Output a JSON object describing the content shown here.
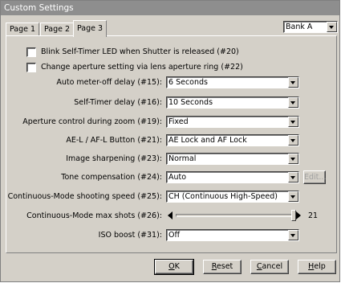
{
  "window": {
    "title": "Custom Settings"
  },
  "tabs": [
    {
      "label": "Page 1"
    },
    {
      "label": "Page 2"
    },
    {
      "label": "Page 3"
    }
  ],
  "bank": {
    "value": "Bank A"
  },
  "checkboxes": [
    {
      "label": "Blink Self-Timer LED when Shutter is released (#20)",
      "checked": false
    },
    {
      "label": "Change aperture setting via lens aperture ring (#22)",
      "checked": false
    }
  ],
  "settings": [
    {
      "label": "Auto meter-off delay (#15):",
      "value": "6 Seconds"
    },
    {
      "label": "Self-Timer delay (#16):",
      "value": "10 Seconds"
    },
    {
      "label": "Aperture control during zoom (#19):",
      "value": "Fixed"
    },
    {
      "label": "AE-L / AF-L Button (#21):",
      "value": "AE Lock and AF Lock"
    },
    {
      "label": "Image sharpening (#23):",
      "value": "Normal"
    },
    {
      "label": "Tone compensation (#24):",
      "value": "Auto"
    },
    {
      "label": "Continuous-Mode shooting speed (#25):",
      "value": "CH (Continuous High-Speed)"
    },
    {
      "label": "Continuous-Mode max shots (#26):",
      "value": "21",
      "fraction": 1.0
    },
    {
      "label": "ISO boost (#31):",
      "value": "Off"
    }
  ],
  "edit_button": {
    "label": "Edit..."
  },
  "buttons": {
    "ok": {
      "label": "OK",
      "underline": "O",
      "rest": "K"
    },
    "reset": {
      "label": "Reset",
      "underline": "R",
      "rest": "eset"
    },
    "cancel": {
      "label": "Cancel",
      "underline": "C",
      "rest": "ancel"
    },
    "help": {
      "label": "Help",
      "underline": "H",
      "rest": "elp"
    }
  },
  "icons": {
    "dropdown": "chevron-down-icon",
    "slider_left": "arrow-left-icon",
    "slider_right": "arrow-right-icon"
  }
}
